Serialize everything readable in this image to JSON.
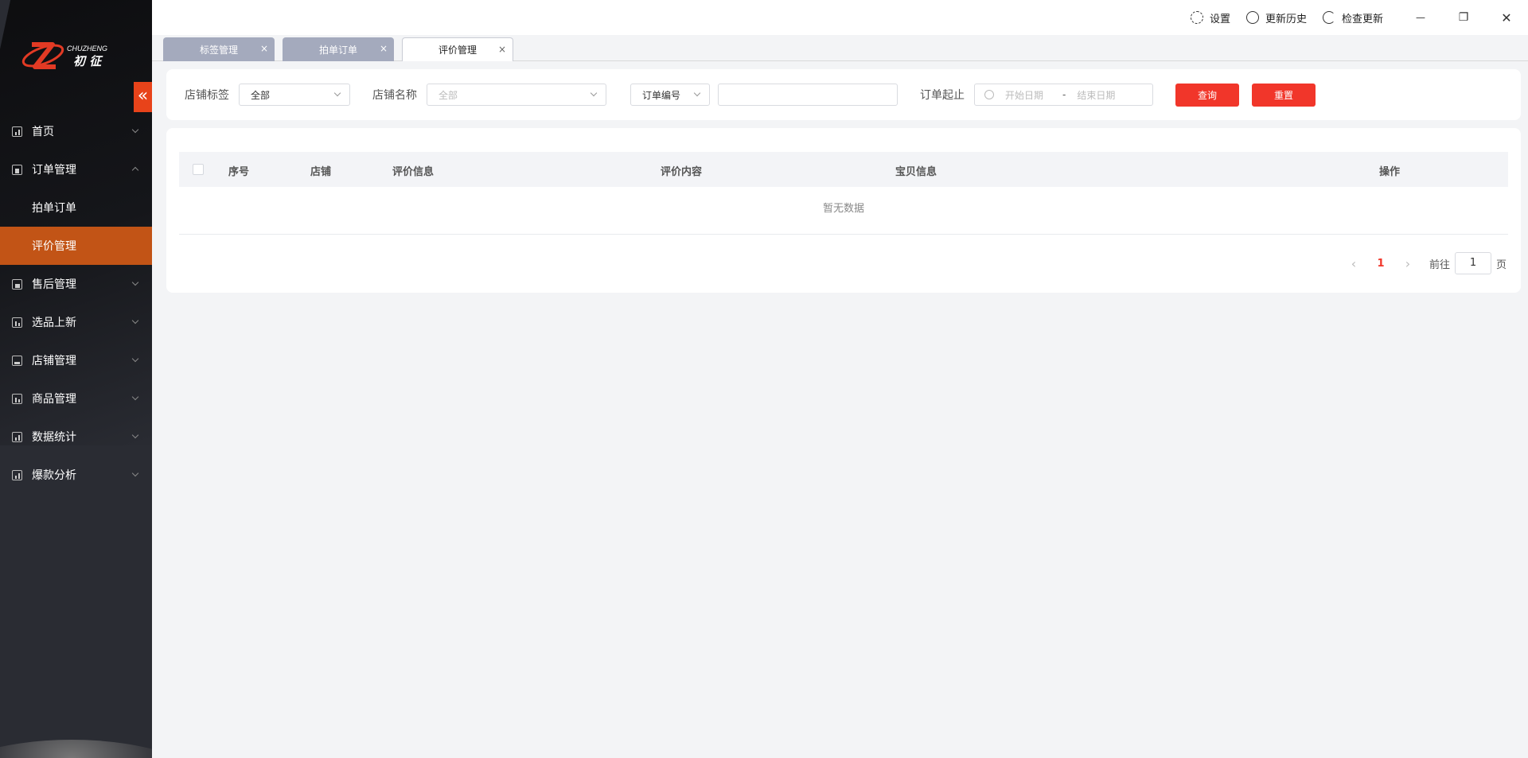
{
  "app": {
    "logo_text_en": "CHUZHENG",
    "logo_text_cn": "初 征",
    "collapse_icon": "«"
  },
  "sidebar": {
    "items": [
      {
        "label": "首页",
        "icon": "chart-icon",
        "has_chevron": true
      },
      {
        "label": "订单管理",
        "icon": "clipboard-icon",
        "has_chevron": true
      },
      {
        "label": "拍单订单",
        "sub": true
      },
      {
        "label": "评价管理",
        "sub": true,
        "active": true
      },
      {
        "label": "售后管理",
        "icon": "service-icon",
        "has_chevron": true
      },
      {
        "label": "选品上新",
        "icon": "product-icon",
        "has_chevron": true
      },
      {
        "label": "店铺管理",
        "icon": "store-icon",
        "has_chevron": true
      },
      {
        "label": "商品管理",
        "icon": "goods-icon",
        "has_chevron": true
      },
      {
        "label": "数据统计",
        "icon": "chart-icon",
        "has_chevron": true
      },
      {
        "label": "爆款分析",
        "icon": "chart-icon",
        "has_chevron": true
      }
    ]
  },
  "topbar": {
    "settings": "设置",
    "history": "更新历史",
    "check_update": "检查更新",
    "minimize": "—",
    "restore": "❐",
    "close": "✕"
  },
  "tabs": [
    {
      "label": "标签管理",
      "close": "×"
    },
    {
      "label": "拍单订单",
      "close": "×"
    },
    {
      "label": "评价管理",
      "close": "×",
      "active": true
    }
  ],
  "filter": {
    "shop_tag_label": "店铺标签",
    "shop_tag_value": "全部",
    "shop_name_label": "店铺名称",
    "shop_name_placeholder": "全部",
    "order_type_value": "订单编号",
    "order_range_label": "订单起止",
    "start_placeholder": "开始日期",
    "separator": "-",
    "end_placeholder": "结束日期",
    "query_button": "查询",
    "reset_button": "重置"
  },
  "table": {
    "columns": [
      "序号",
      "店铺",
      "评价信息",
      "评价内容",
      "宝贝信息",
      "操作"
    ],
    "empty_text": "暂无数据"
  },
  "pager": {
    "prev": "‹",
    "current": "1",
    "next": "›",
    "goto_label": "前往",
    "goto_value": "1",
    "page_unit": "页"
  },
  "colors": {
    "accent": "#f1362a",
    "sidebar_active": "#c25416",
    "sidebar_bg": "#2a2c33"
  }
}
